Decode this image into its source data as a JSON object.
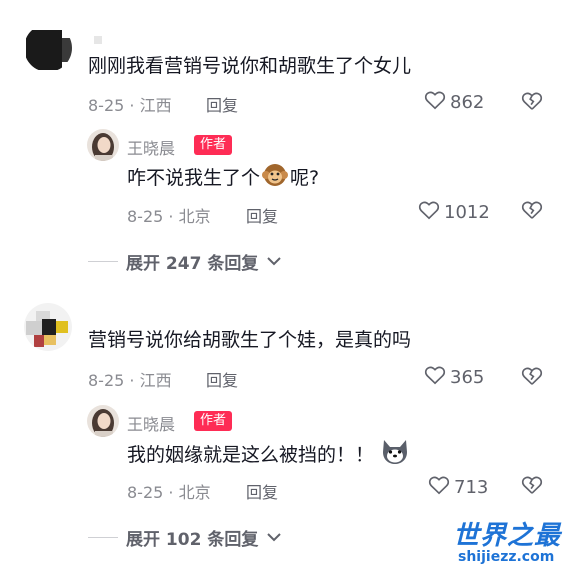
{
  "comments": [
    {
      "text": "刚刚我看营销号说你和胡歌生了个女儿",
      "date": "8-25",
      "location": "江西",
      "reply_label": "回复",
      "likes": "862",
      "author_reply": {
        "name": "王晓晨",
        "badge": "作者",
        "text_before": "咋不说我生了个",
        "emoji": "monkey-emoji",
        "text_after": "呢?",
        "date": "8-25",
        "location": "北京",
        "reply_label": "回复",
        "likes": "1012"
      },
      "expand_label": "展开 247 条回复"
    },
    {
      "text": "营销号说你给胡歌生了个娃，是真的吗",
      "date": "8-25",
      "location": "江西",
      "reply_label": "回复",
      "likes": "365",
      "author_reply": {
        "name": "王晓晨",
        "badge": "作者",
        "text_before": "我的姻缘就是这么被挡的！！",
        "emoji": "dog-emoji",
        "text_after": "",
        "date": "8-25",
        "location": "北京",
        "reply_label": "回复",
        "likes": "713"
      },
      "expand_label": "展开 102 条回复"
    }
  ],
  "watermark": {
    "title": "世界之最",
    "url": "shijiezz.com"
  },
  "colors": {
    "badge": "#fe2c55",
    "meta": "#8a8b91",
    "text": "#161823",
    "watermark": "#1e73d6"
  }
}
